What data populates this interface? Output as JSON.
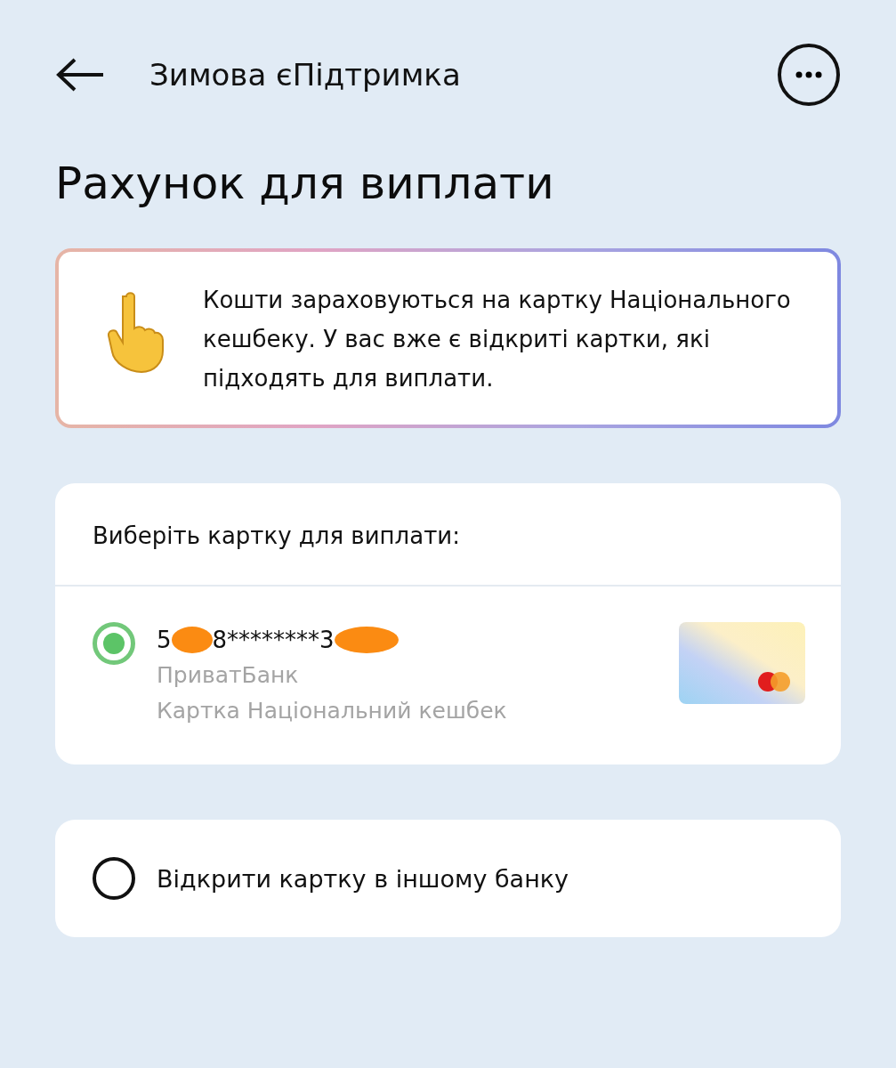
{
  "header": {
    "title": "Зимова єПідтримка"
  },
  "heading": "Рахунок для виплати",
  "notice": {
    "text": "Кошти зараховуються на картку Національного кешбеку. У вас вже є відкриті картки, які підходять для виплати."
  },
  "card_selection": {
    "title": "Виберіть картку для виплати:",
    "cards": [
      {
        "number_parts": [
          "5",
          "8********3"
        ],
        "bank": "ПриватБанк",
        "card_type": "Картка Національний кешбек",
        "selected": true
      }
    ]
  },
  "other_option": {
    "label": "Відкрити картку в іншому банку",
    "selected": false
  }
}
